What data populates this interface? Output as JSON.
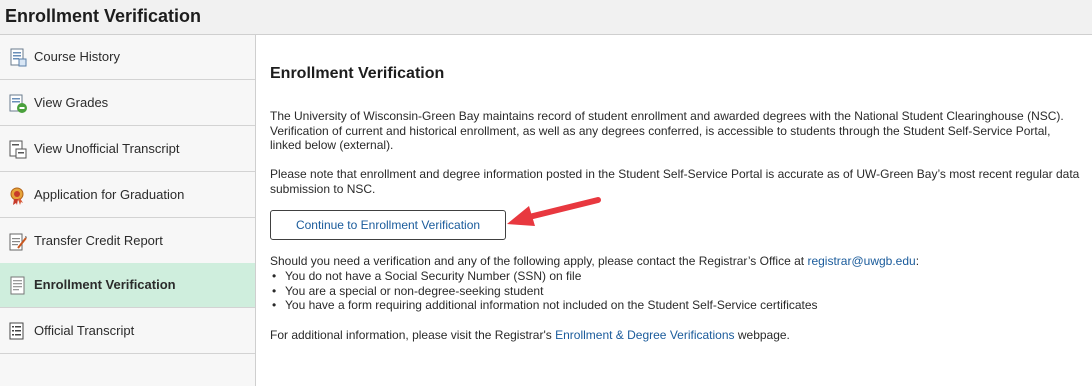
{
  "header": {
    "title": "Enrollment Verification"
  },
  "sidebar": {
    "items": [
      {
        "label": "Course History",
        "icon": "course-history-icon",
        "active": false
      },
      {
        "label": "View Grades",
        "icon": "grades-icon",
        "active": false
      },
      {
        "label": "View Unofficial Transcript",
        "icon": "transcript-icon",
        "active": false
      },
      {
        "label": "Application for Graduation",
        "icon": "graduation-ribbon-icon",
        "active": false
      },
      {
        "label": "Transfer Credit Report",
        "icon": "transfer-report-icon",
        "active": false
      },
      {
        "label": "Enrollment Verification",
        "icon": "enrollment-icon",
        "active": true
      },
      {
        "label": "Official Transcript",
        "icon": "official-transcript-icon",
        "active": false
      }
    ]
  },
  "main": {
    "title": "Enrollment Verification",
    "para1": "The University of Wisconsin-Green Bay maintains record of student enrollment and awarded degrees with the National Student Clearinghouse (NSC). Verification of current and historical enrollment, as well as any degrees conferred, is accessible to students through the Student Self-Service Portal, linked below (external).",
    "para2": "Please note that enrollment and degree information posted in the Student Self-Service Portal is accurate as of UW-Green Bay’s most recent regular data submission to NSC.",
    "button_label": "Continue to Enrollment Verification",
    "para3_prefix": "Should you need a verification and any of the following apply, please contact the Registrar’s Office at ",
    "para3_link": "registrar@uwgb.edu",
    "para3_suffix": ":",
    "bullets": [
      "You do not have a Social Security Number (SSN) on file",
      "You are a special or non-degree-seeking student",
      "You have a form requiring additional information not included on the Student Self-Service certificates"
    ],
    "para4_prefix": "For additional information, please visit the Registrar's ",
    "para4_link": "Enrollment & Degree Verifications",
    "para4_suffix": " webpage."
  },
  "colors": {
    "active_nav": "#cfeedd",
    "link": "#1a5b9b",
    "annotation_arrow": "#e8383f"
  }
}
